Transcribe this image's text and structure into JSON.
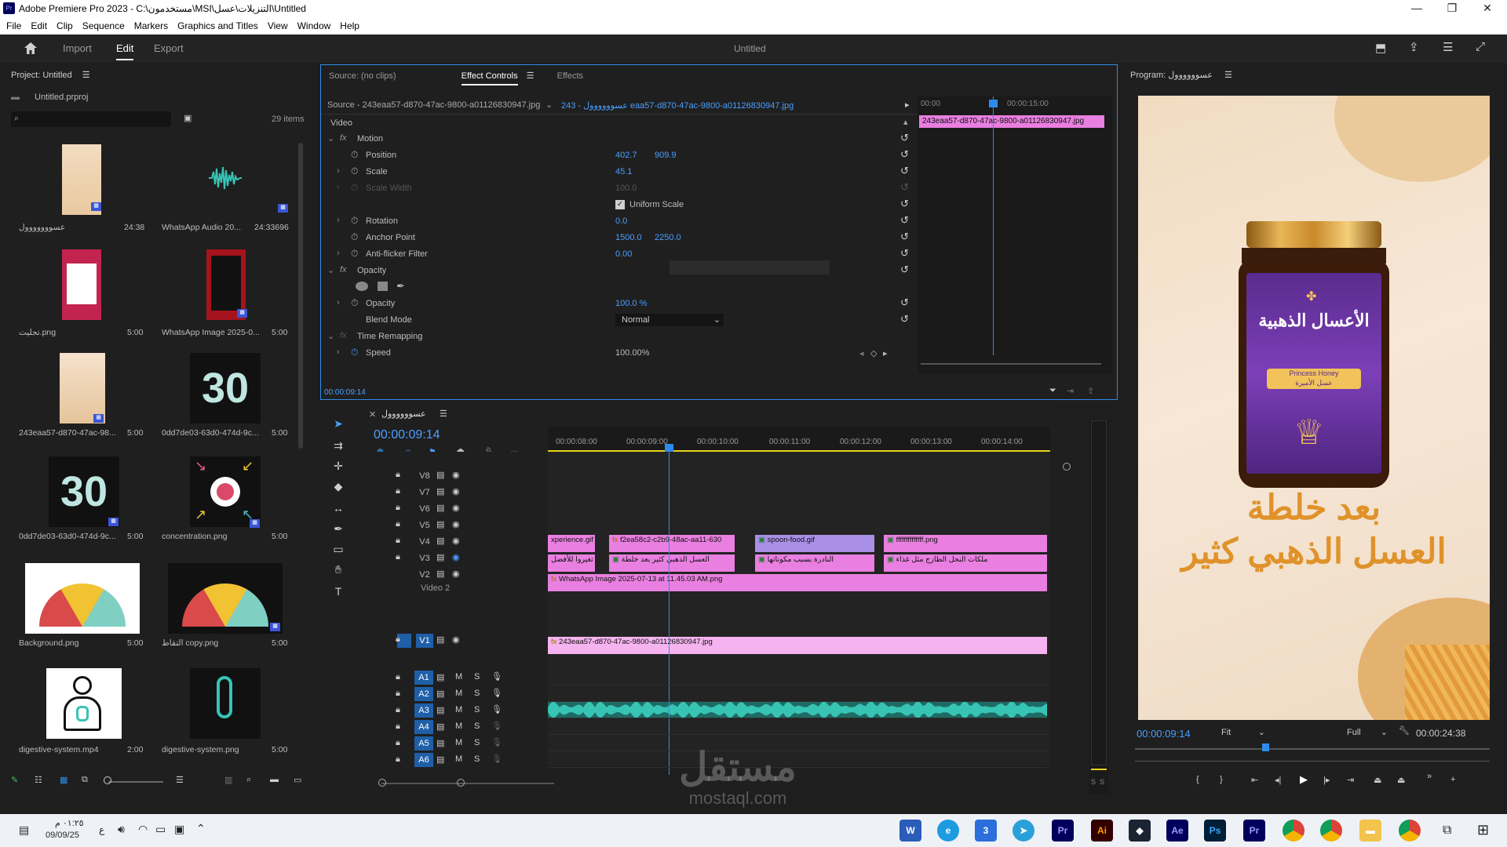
{
  "window": {
    "title": "Adobe Premiere Pro 2023 - C:\\مستخدمون\\MSI\\التنزيلات\\عسل\\Untitled"
  },
  "menu": [
    "File",
    "Edit",
    "Clip",
    "Sequence",
    "Markers",
    "Graphics and Titles",
    "View",
    "Window",
    "Help"
  ],
  "appbar": {
    "home": "home",
    "import": "Import",
    "edit": "Edit",
    "export": "Export",
    "doc_title": "Untitled"
  },
  "project": {
    "title": "Project: Untitled",
    "file": "Untitled.prproj",
    "items_count": "29 items",
    "items": [
      {
        "name": "عسووووووول",
        "dur": "24:38"
      },
      {
        "name": "WhatsApp Audio 20...",
        "dur": "24:33696"
      },
      {
        "name": "تجليت.png",
        "dur": "5:00"
      },
      {
        "name": "WhatsApp Image 2025-0...",
        "dur": "5:00"
      },
      {
        "name": "243eaa57-d870-47ac-98...",
        "dur": "5:00"
      },
      {
        "name": "0dd7de03-63d0-474d-9c...",
        "dur": "5:00"
      },
      {
        "name": "0dd7de03-63d0-474d-9c...",
        "dur": "5:00"
      },
      {
        "name": "concentration.png",
        "dur": "5:00"
      },
      {
        "name": "Background.png",
        "dur": "5:00"
      },
      {
        "name": "التقاط copy.png",
        "dur": "5:00"
      },
      {
        "name": "digestive-system.mp4",
        "dur": "2:00"
      },
      {
        "name": "digestive-system.png",
        "dur": "5:00"
      }
    ],
    "thumb_texts": {
      "thirty": "30"
    }
  },
  "effect_controls": {
    "tabs": {
      "source": "Source: (no clips)",
      "effect_controls": "Effect Controls",
      "effects": "Effects"
    },
    "source_line": "Source - 243eaa57-d870-47ac-9800-a01126830947.jpg",
    "clip_select": "243 - عسوووووول eaa57-d870-47ac-9800-a01126830947.jpg",
    "section": "Video",
    "motion": "Motion",
    "position": {
      "label": "Position",
      "x": "402.7",
      "y": "909.9"
    },
    "scale": {
      "label": "Scale",
      "v": "45.1"
    },
    "scale_width": {
      "label": "Scale Width",
      "v": "100.0"
    },
    "uniform": "Uniform Scale",
    "rotation": {
      "label": "Rotation",
      "v": "0.0"
    },
    "anchor": {
      "label": "Anchor Point",
      "x": "1500.0",
      "y": "2250.0"
    },
    "antiflicker": {
      "label": "Anti-flicker Filter",
      "v": "0.00"
    },
    "opacity_section": "Opacity",
    "opacity": {
      "label": "Opacity",
      "v": "100.0 %"
    },
    "blend": {
      "label": "Blend Mode",
      "v": "Normal"
    },
    "time_remap": "Time Remapping",
    "speed": {
      "label": "Speed",
      "v": "100.00%"
    },
    "timecode": "00:00:09:14",
    "mini_ruler": [
      "00:00",
      "00:00:15:00"
    ],
    "mini_clip": "243eaa57-d870-47ac-9800-a01126830947.jpg"
  },
  "timeline": {
    "seq_name": "عسوووووول",
    "timecode": "00:00:09:14",
    "ruler": [
      "00:00:08:00",
      "00:00:09:00",
      "00:00:10:00",
      "00:00:11:00",
      "00:00:12:00",
      "00:00:13:00",
      "00:00:14:00"
    ],
    "video_tracks": [
      "V8",
      "V7",
      "V6",
      "V5",
      "V4",
      "V3",
      "V2",
      "V1"
    ],
    "video2_label": "Video 2",
    "audio_tracks": [
      "A1",
      "A2",
      "A3",
      "A4",
      "A5",
      "A6"
    ],
    "clips": {
      "v5a": "xperience.gif",
      "v5b": "f2ea58c2-c2b9-48ac-aa11-630",
      "v5c": "spoon-food.gif",
      "v5d": "ffffffffffffff.png",
      "v4a": "تغيروا للأفضل",
      "v4b": "العسل الذهبي كثير بعد خلطة",
      "v4c": "النادرة بسبب مكوناتها",
      "v4d": "ملكات النحل الطازج مثل غذاء",
      "v3": "WhatsApp Image 2025-07-13 at 11.45.03 AM.png",
      "v1": "243eaa57-d870-47ac-9800-a01126830947.jpg"
    },
    "audio_labels": {
      "m": "M",
      "s": "S"
    }
  },
  "program": {
    "title": "Program: عسوووووول",
    "timecode": "00:00:09:14",
    "fit": "Fit",
    "full": "Full",
    "duration": "00:00:24:38",
    "jar_brand_ar": "الأعسال الذهبية",
    "jar_label_en": "Princess Honey",
    "jar_label_ar": "عسل الأميرة",
    "overlay_line1": "بعد خلطة",
    "overlay_line2": "العسل الذهبي كثير"
  },
  "watermark": {
    "ar": "مستقل",
    "en": "mostaql.com"
  },
  "taskbar": {
    "time": "٠١:٢٥ م",
    "date": "09/09/25",
    "lang": "ع"
  },
  "colors": {
    "accent": "#2d8ceb",
    "clip_pink": "#e97fe0",
    "clip_v1": "#f5b3ef",
    "audio": "#37c4b5",
    "bg": "#1e1e1e"
  }
}
